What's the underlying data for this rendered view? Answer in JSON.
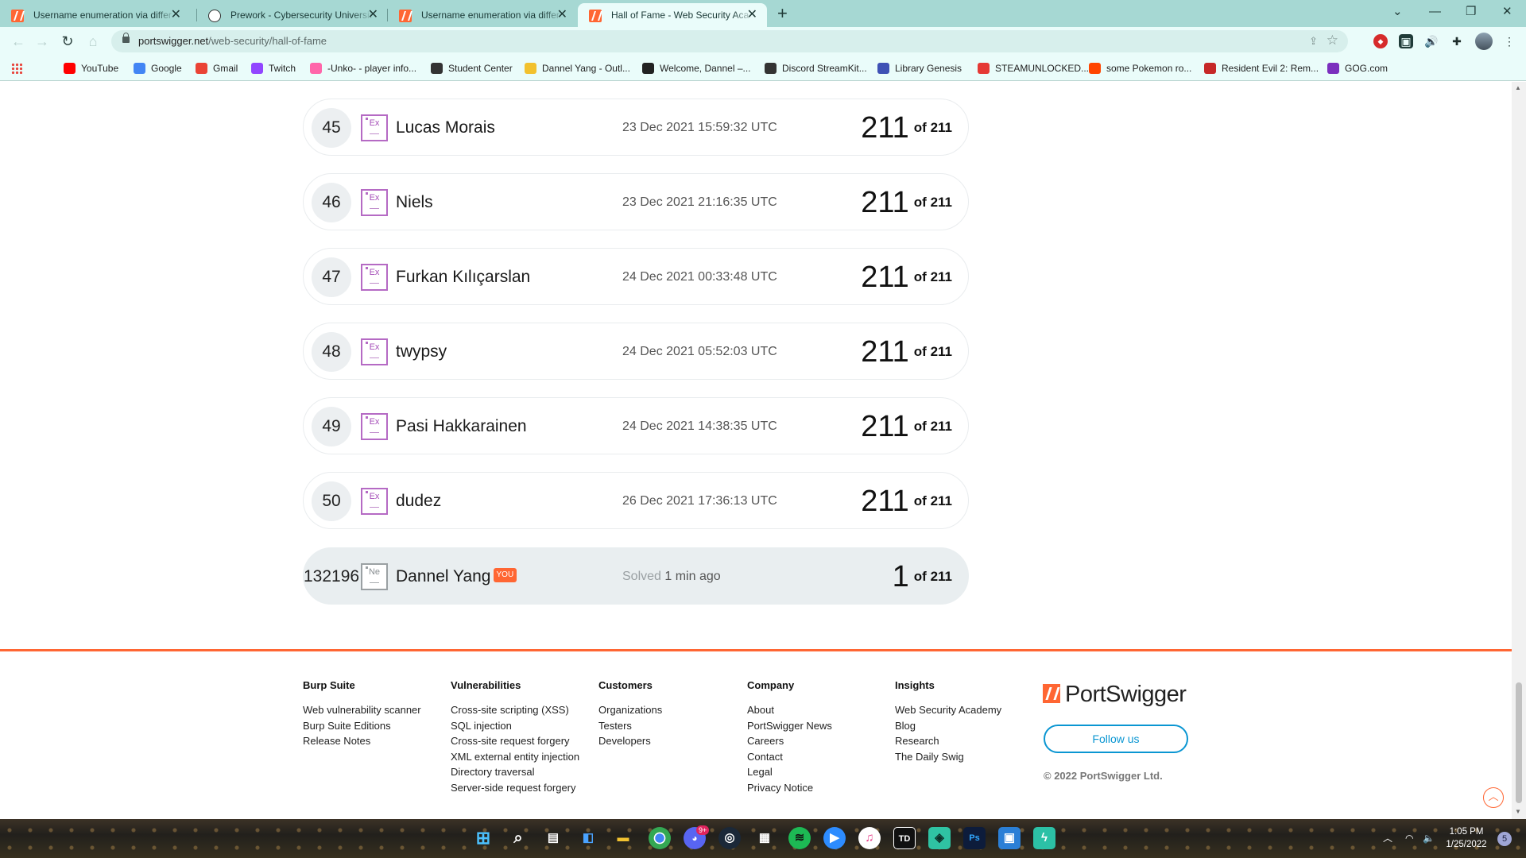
{
  "browser": {
    "tabs": [
      {
        "title": "Username enumeration via differ",
        "favicon": "portswigger-icon"
      },
      {
        "title": "Prework - Cybersecurity Universit",
        "favicon": "codepath-icon"
      },
      {
        "title": "Username enumeration via differ",
        "favicon": "portswigger-icon"
      },
      {
        "title": "Hall of Fame - Web Security Aca",
        "favicon": "portswigger-icon"
      }
    ],
    "tab_close": "✕",
    "new_tab": "+",
    "url_domain": "portswigger.net",
    "url_path": "/web-security/hall-of-fame",
    "bookmarks": [
      {
        "label": "YouTube",
        "icon": "youtube-icon",
        "color": "#ff0000"
      },
      {
        "label": "Google",
        "icon": "google-icon",
        "color": "#4285f4"
      },
      {
        "label": "Gmail",
        "icon": "gmail-icon",
        "color": "#ea4335"
      },
      {
        "label": "Twitch",
        "icon": "twitch-icon",
        "color": "#9146ff"
      },
      {
        "label": "-Unko- - player info...",
        "icon": "osu-icon",
        "color": "#ff66aa"
      },
      {
        "label": "Student Center",
        "icon": "globe-icon",
        "color": "#333333"
      },
      {
        "label": "Dannel Yang - Outl...",
        "icon": "outlook-icon",
        "color": "#f2c12e"
      },
      {
        "label": "Welcome, Dannel –...",
        "icon": "blackboard-icon",
        "color": "#222222"
      },
      {
        "label": "Discord StreamKit...",
        "icon": "globe-icon",
        "color": "#333333"
      },
      {
        "label": "Library Genesis",
        "icon": "libgen-icon",
        "color": "#3f51b5"
      },
      {
        "label": "STEAMUNLOCKED...",
        "icon": "steamunlocked-icon",
        "color": "#e53935"
      },
      {
        "label": "some Pokemon ro...",
        "icon": "reddit-icon",
        "color": "#ff4500"
      },
      {
        "label": "Resident Evil 2: Rem...",
        "icon": "pc-icon",
        "color": "#c62828"
      },
      {
        "label": "GOG.com",
        "icon": "gog-icon",
        "color": "#7b2fbe"
      }
    ]
  },
  "leaderboard": [
    {
      "rank": "45",
      "level": "Ex",
      "name": "Lucas Morais",
      "date": "23 Dec 2021 15:59:32 UTC",
      "solved": "211",
      "of": "of 211"
    },
    {
      "rank": "46",
      "level": "Ex",
      "name": "Niels",
      "date": "23 Dec 2021 21:16:35 UTC",
      "solved": "211",
      "of": "of 211"
    },
    {
      "rank": "47",
      "level": "Ex",
      "name": "Furkan Kılıçarslan",
      "date": "24 Dec 2021 00:33:48 UTC",
      "solved": "211",
      "of": "of 211"
    },
    {
      "rank": "48",
      "level": "Ex",
      "name": "twypsy",
      "date": "24 Dec 2021 05:52:03 UTC",
      "solved": "211",
      "of": "of 211"
    },
    {
      "rank": "49",
      "level": "Ex",
      "name": "Pasi Hakkarainen",
      "date": "24 Dec 2021 14:38:35 UTC",
      "solved": "211",
      "of": "of 211"
    },
    {
      "rank": "50",
      "level": "Ex",
      "name": "dudez",
      "date": "26 Dec 2021 17:36:13 UTC",
      "solved": "211",
      "of": "of 211"
    }
  ],
  "current_user": {
    "rank": "132196",
    "level": "Ne",
    "name": "Dannel Yang",
    "badge": "YOU",
    "solved_prefix": "Solved",
    "solved_time": "1 min ago",
    "solved": "1",
    "of": "of 211"
  },
  "footer": {
    "columns": [
      {
        "heading": "Burp Suite",
        "links": [
          "Web vulnerability scanner",
          "Burp Suite Editions",
          "Release Notes"
        ]
      },
      {
        "heading": "Vulnerabilities",
        "links": [
          "Cross-site scripting (XSS)",
          "SQL injection",
          "Cross-site request forgery",
          "XML external entity injection",
          "Directory traversal",
          "Server-side request forgery"
        ]
      },
      {
        "heading": "Customers",
        "links": [
          "Organizations",
          "Testers",
          "Developers"
        ]
      },
      {
        "heading": "Company",
        "links": [
          "About",
          "PortSwigger News",
          "Careers",
          "Contact",
          "Legal",
          "Privacy Notice"
        ]
      },
      {
        "heading": "Insights",
        "links": [
          "Web Security Academy",
          "Blog",
          "Research",
          "The Daily Swig"
        ]
      }
    ],
    "logo_text": "PortSwigger",
    "follow_label": "Follow us",
    "copyright": "© 2022 PortSwigger Ltd."
  },
  "taskbar": {
    "time": "1:05 PM",
    "date": "1/25/2022",
    "notifications": "5",
    "discord_badge": "9+",
    "apps": [
      "windows-start-icon",
      "search-icon",
      "task-view-icon",
      "widgets-icon",
      "file-explorer-icon",
      "chrome-icon",
      "discord-icon",
      "steam-icon",
      "microsoft-store-icon",
      "spotify-icon",
      "zoom-icon",
      "itunes-icon",
      "tweetdeck-icon",
      "robinhood-icon",
      "photoshop-icon",
      "blue-app-icon",
      "bolt-app-icon"
    ]
  },
  "colors": {
    "accent": "#ff6633",
    "level_purple": "#b56ac4",
    "follow_blue": "#0a96d2",
    "tab_strip": "#a6d8d3"
  }
}
